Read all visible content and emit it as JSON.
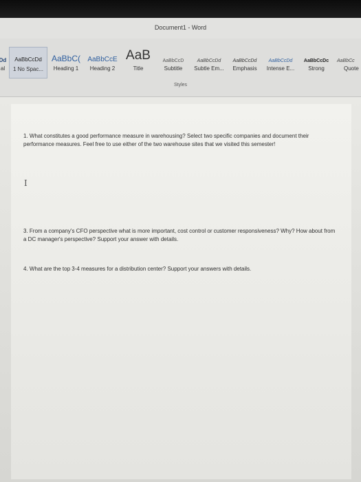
{
  "window": {
    "title": "Document1 - Word"
  },
  "ribbon": {
    "styles_group_label": "Styles",
    "styles": [
      {
        "preview": "Dd",
        "label": "al"
      },
      {
        "preview": "AaBbCcDd",
        "label": "1 No Spac..."
      },
      {
        "preview": "AaBbC(",
        "label": "Heading 1"
      },
      {
        "preview": "AaBbCcE",
        "label": "Heading 2"
      },
      {
        "preview": "AaB",
        "label": "Title"
      },
      {
        "preview": "AaBbCcD",
        "label": "Subtitle"
      },
      {
        "preview": "AaBbCcDd",
        "label": "Subtle Em..."
      },
      {
        "preview": "AaBbCcDd",
        "label": "Emphasis"
      },
      {
        "preview": "AaBbCcDd",
        "label": "Intense E..."
      },
      {
        "preview": "AaBbCcDc",
        "label": "Strong"
      },
      {
        "preview": "AaBbCc",
        "label": "Quote"
      }
    ]
  },
  "document": {
    "questions": [
      "1. What constitutes a good performance measure in warehousing? Select two specific companies and document their performance measures. Feel free to use either of the two warehouse sites that we visited this semester!",
      "3. From a company's CFO perspective what is more important, cost control or customer responsiveness? Why? How about from a DC manager's perspective? Support your answer with details.",
      "4. What are the top 3-4 measures for a distribution center? Support your answers with details."
    ],
    "cursor_glyph": "I"
  }
}
